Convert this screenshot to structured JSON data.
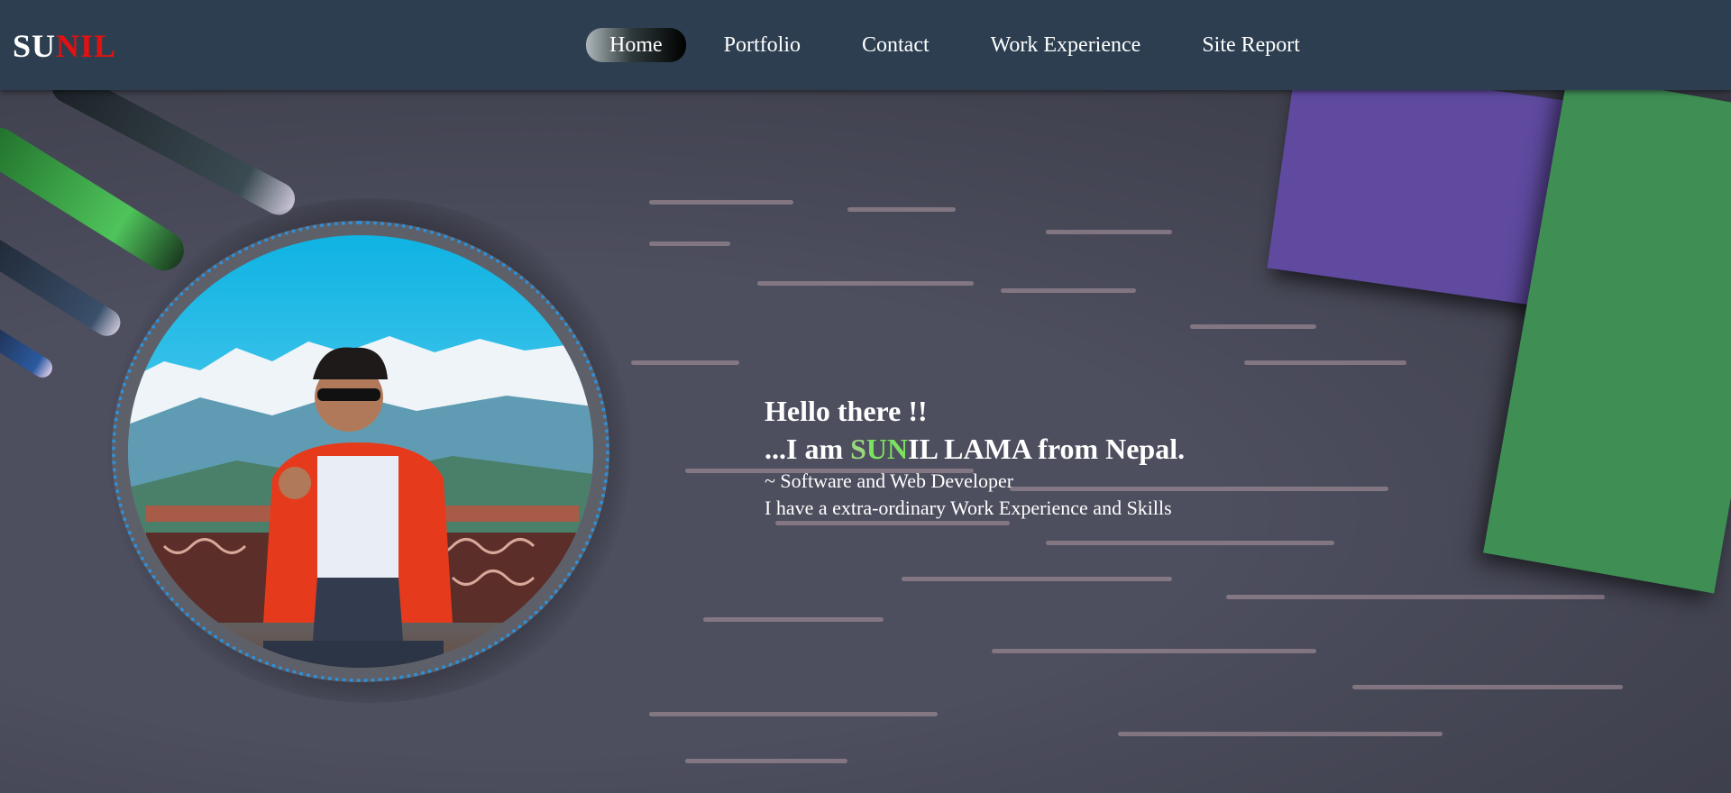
{
  "header": {
    "logo": {
      "part1": "SU",
      "part2": "NIL"
    },
    "nav": [
      {
        "label": "Home",
        "active": true
      },
      {
        "label": "Portfolio",
        "active": false
      },
      {
        "label": "Contact",
        "active": false
      },
      {
        "label": "Work Experience",
        "active": false
      },
      {
        "label": "Site Report",
        "active": false
      }
    ]
  },
  "intro": {
    "greeting": "Hello there !!",
    "name_prefix": "...I am ",
    "name_s": "S",
    "name_un": "UN",
    "name_rest": "IL LAMA from Nepal.",
    "role": "~ Software and Web Developer",
    "tagline": "I have a extra-ordinary Work Experience and Skills"
  },
  "colors": {
    "nav_bg": "#2c3e50",
    "logo_red": "#e01212",
    "name_green": "#7be15e",
    "avatar_border": "#2f8fd6"
  }
}
